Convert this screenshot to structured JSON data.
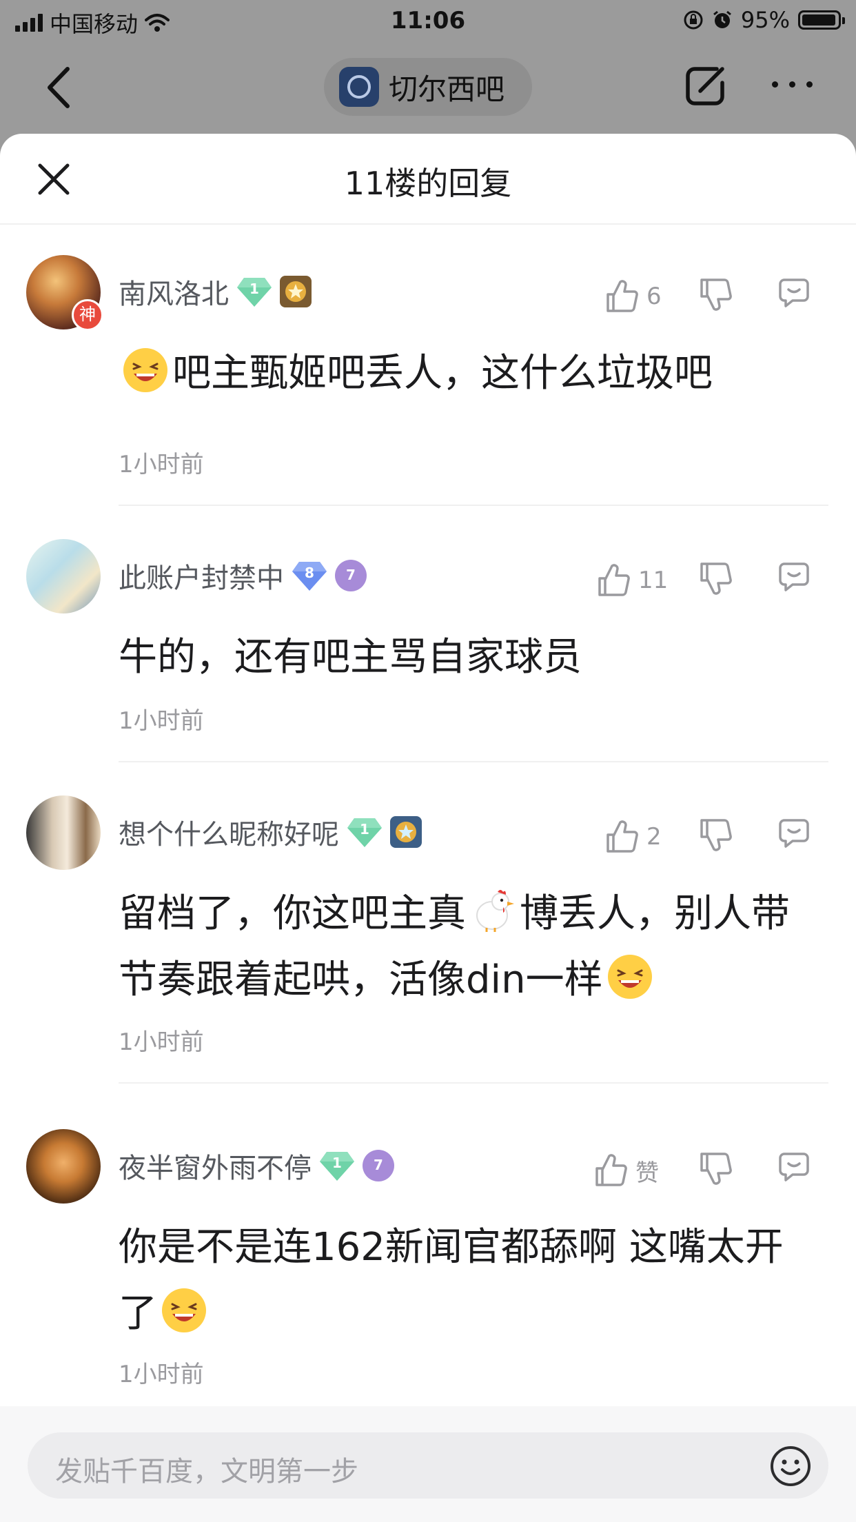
{
  "status_bar": {
    "carrier": "中国移动",
    "time": "11:06",
    "battery": "95%",
    "battery_level": 0.95
  },
  "nav": {
    "forum_name": "切尔西吧"
  },
  "sheet": {
    "title": "11楼的回复"
  },
  "replies": [
    {
      "username": "南风洛北",
      "gem_level": "1",
      "avatar_badge": "神",
      "likes": "6",
      "content_text": "吧主甄姬吧丢人，这什么垃圾吧",
      "time": "1小时前"
    },
    {
      "username": "此账户封禁中",
      "gem_level": "8",
      "medal_level": "7",
      "likes": "11",
      "content_text": "牛的，还有吧主骂自家球员",
      "time": "1小时前"
    },
    {
      "username": "想个什么昵称好呢",
      "gem_level": "1",
      "likes": "2",
      "content_part1": "留档了，你这吧主真",
      "content_part2": "博丢人，别人带节奏跟着起哄，活像din一样",
      "time": "1小时前"
    },
    {
      "username": "夜半窗外雨不停",
      "gem_level": "1",
      "medal_level": "7",
      "likes": "赞",
      "content_text": "你是不是连162新闻官都舔啊 这嘴太开了",
      "time": "1小时前"
    }
  ],
  "input": {
    "placeholder": "发贴千百度，文明第一步"
  },
  "colors": {
    "gem_green": "#6fd3a8",
    "gem_blue": "#6b8ef0",
    "badge_red": "#e84a3c",
    "medal_purple": "#a78bd8",
    "medal_gold": "#d99a2b"
  }
}
